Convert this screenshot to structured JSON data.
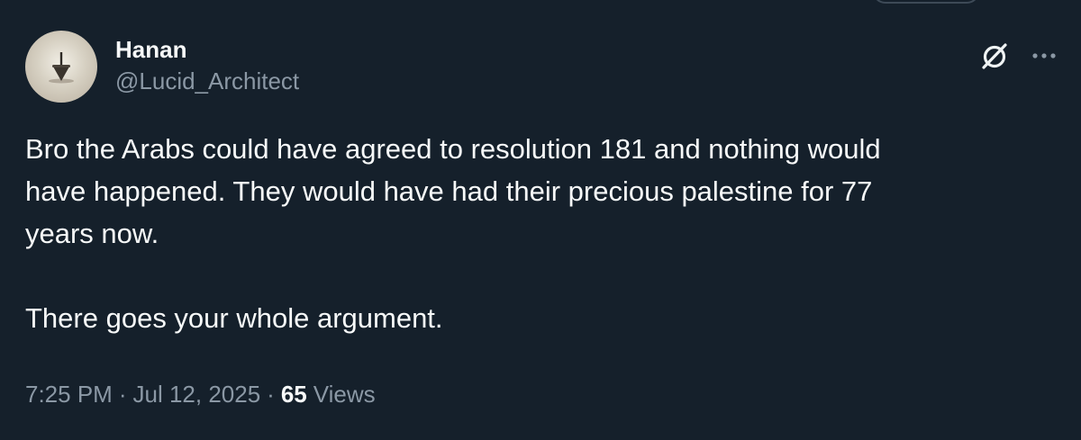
{
  "author": {
    "display_name": "Hanan",
    "handle": "@Lucid_Architect"
  },
  "header_actions": {
    "grok_icon": "grok-slash-circle-icon",
    "more_icon": "more-horizontal-icon"
  },
  "tweet": {
    "text": "Bro the Arabs could have agreed to resolution 181 and nothing would\nhave happened. They would have had their precious palestine for 77\nyears now.\n\nThere goes your whole argument."
  },
  "meta": {
    "time": "7:25 PM",
    "separator": "·",
    "date": "Jul 12, 2025",
    "views_count": "65",
    "views_label": "Views"
  },
  "colors": {
    "background": "#15202b",
    "text_primary": "#f7f9f9",
    "text_secondary": "#8b98a5"
  }
}
